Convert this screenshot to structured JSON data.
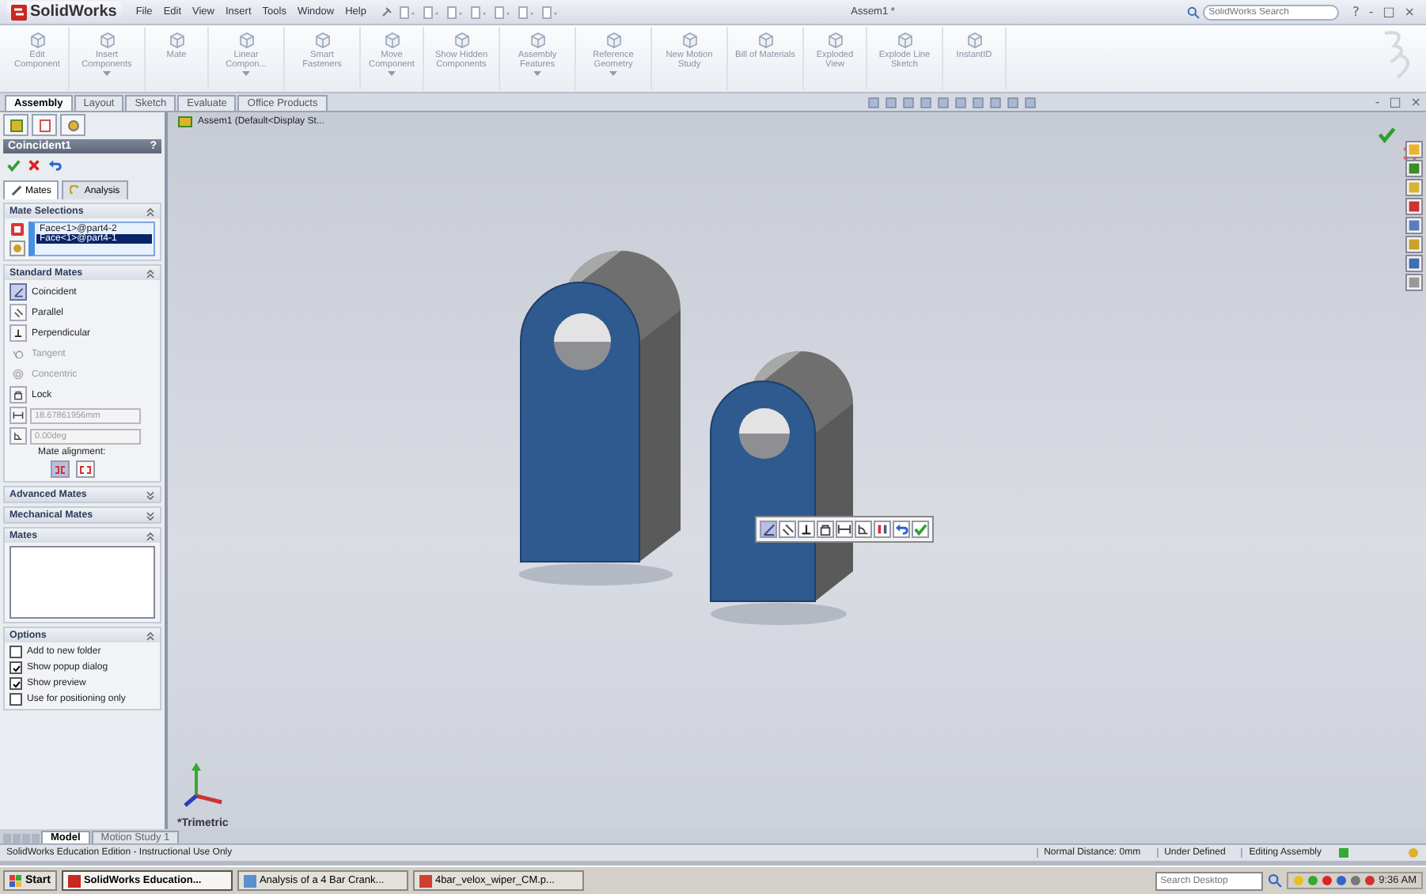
{
  "app": {
    "logo": "SolidWorks",
    "menu": [
      "File",
      "Edit",
      "View",
      "Insert",
      "Tools",
      "Window",
      "Help"
    ],
    "title": "Assem1 *",
    "search": {
      "placeholder": "SolidWorks Search"
    },
    "window_buttons": [
      "?",
      "-",
      "□",
      "×"
    ]
  },
  "command_manager": [
    {
      "label": "Edit Component",
      "dropdown": false
    },
    {
      "label": "Insert Components",
      "dropdown": true
    },
    {
      "label": "Mate",
      "dropdown": false
    },
    {
      "label": "Linear Compon...",
      "dropdown": true
    },
    {
      "label": "Smart Fasteners",
      "dropdown": false
    },
    {
      "label": "Move Component",
      "dropdown": true
    },
    {
      "label": "Show Hidden Components",
      "dropdown": false
    },
    {
      "label": "Assembly Features",
      "dropdown": true
    },
    {
      "label": "Reference Geometry",
      "dropdown": true
    },
    {
      "label": "New Motion Study",
      "dropdown": false
    },
    {
      "label": "Bill of Materials",
      "dropdown": false
    },
    {
      "label": "Exploded View",
      "dropdown": false
    },
    {
      "label": "Explode Line Sketch",
      "dropdown": false
    },
    {
      "label": "InstantID",
      "dropdown": false
    }
  ],
  "tabs": [
    {
      "label": "Assembly",
      "selected": true
    },
    {
      "label": "Layout",
      "selected": false
    },
    {
      "label": "Sketch",
      "selected": false
    },
    {
      "label": "Evaluate",
      "selected": false
    },
    {
      "label": "Office Products",
      "selected": false
    }
  ],
  "document_buttons": [
    "-",
    "□",
    "×"
  ],
  "property_manager": {
    "title": "Coincident1",
    "help": "?",
    "tabs": [
      {
        "label": "Mates",
        "selected": true
      },
      {
        "label": "Analysis",
        "selected": false
      }
    ],
    "sections": [
      {
        "kind": "selections",
        "title": "Mate Selections",
        "expanded": true,
        "items": [
          {
            "label": "Face<1>@part4-2",
            "selected": false
          },
          {
            "label": "Face<1>@part4-1",
            "selected": true
          }
        ]
      },
      {
        "kind": "standard",
        "title": "Standard Mates",
        "expanded": true,
        "items": [
          {
            "kind": "coincident",
            "label": "Coincident",
            "selected": true,
            "disabled": false
          },
          {
            "kind": "parallel",
            "label": "Parallel",
            "selected": false,
            "disabled": false
          },
          {
            "kind": "perpendicular",
            "label": "Perpendicular",
            "selected": false,
            "disabled": false
          },
          {
            "kind": "tangent",
            "label": "Tangent",
            "selected": false,
            "disabled": true
          },
          {
            "kind": "concentric",
            "label": "Concentric",
            "selected": false,
            "disabled": true
          },
          {
            "kind": "lock",
            "label": "Lock",
            "selected": false,
            "disabled": false
          },
          {
            "kind": "distance",
            "value": "18.67861956mm",
            "selected": false,
            "disabled": true
          },
          {
            "kind": "angle",
            "value": "0.00deg",
            "selected": false,
            "disabled": true
          }
        ],
        "alignment_label": "Mate alignment:",
        "alignment": [
          {
            "selected": true
          },
          {
            "selected": false
          }
        ]
      },
      {
        "kind": "collapsed",
        "title": "Advanced Mates",
        "expanded": false
      },
      {
        "kind": "collapsed",
        "title": "Mechanical Mates",
        "expanded": false
      },
      {
        "kind": "list",
        "title": "Mates",
        "expanded": true
      },
      {
        "kind": "options",
        "title": "Options",
        "expanded": true,
        "items": [
          {
            "label": "Add to new folder",
            "checked": false
          },
          {
            "label": "Show popup dialog",
            "checked": true
          },
          {
            "label": "Show preview",
            "checked": true
          },
          {
            "label": "Use for positioning only",
            "checked": false
          }
        ]
      }
    ]
  },
  "feature_tree": {
    "root": "Assem1  (Default<Display St..."
  },
  "viewport": {
    "view_label": "*Trimetric",
    "popup_toolbar": [
      {
        "kind": "coincident",
        "selected": true
      },
      {
        "kind": "parallel",
        "selected": false
      },
      {
        "kind": "perpendicular",
        "selected": false
      },
      {
        "kind": "lock",
        "selected": false
      },
      {
        "kind": "distance",
        "selected": false
      },
      {
        "kind": "angle",
        "selected": false
      },
      {
        "kind": "flip",
        "selected": false
      },
      {
        "kind": "undo",
        "selected": false
      },
      {
        "kind": "ok",
        "selected": false
      }
    ]
  },
  "bottom_tabs": [
    {
      "label": "Model",
      "selected": true
    },
    {
      "label": "Motion Study 1",
      "selected": false
    }
  ],
  "status_bar": {
    "message": "SolidWorks Education Edition - Instructional Use Only",
    "fields": [
      "Normal Distance: 0mm",
      "Under Defined",
      "Editing Assembly"
    ]
  },
  "taskbar": {
    "start": "Start",
    "tasks": [
      {
        "label": "SolidWorks Education...",
        "selected": true
      },
      {
        "label": "Analysis of a 4 Bar Crank...",
        "selected": false
      },
      {
        "label": "4bar_velox_wiper_CM.p...",
        "selected": false
      }
    ],
    "search": {
      "placeholder": "Search Desktop"
    },
    "clock": "9:36 AM"
  }
}
